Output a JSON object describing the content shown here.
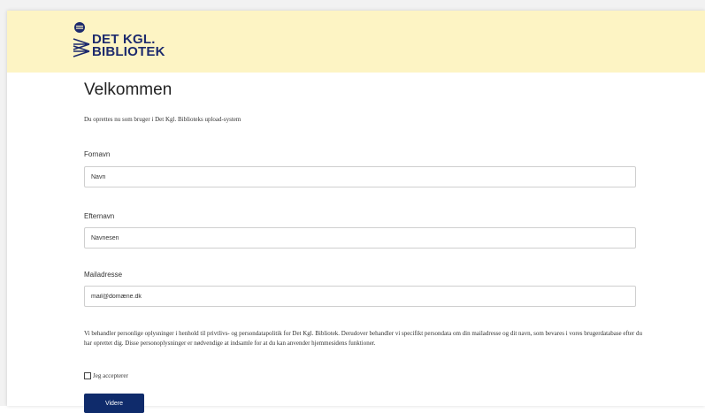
{
  "header": {
    "logo_line1": "DET KGL.",
    "logo_line2": "BIBLIOTEK",
    "background": "#fdf4c4",
    "brand_color": "#1d2a6d"
  },
  "main": {
    "title": "Velkommen",
    "subtitle": "Du oprettes nu som bruger i Det Kgl. Biblioteks upload-system"
  },
  "form": {
    "first_name": {
      "label": "Fornavn",
      "value": "Navn"
    },
    "last_name": {
      "label": "Efternavn",
      "value": "Navnesen"
    },
    "email": {
      "label": "Mailadresse",
      "value": "mail@domæne.dk"
    },
    "policy_text": "Vi behandler personlige oplysninger i henhold til privtlivs- og persondatapolitik for Det Kgl. Bibliotek. Derudover behandler vi specifikt persondata om din mailadresse og dit navn, som bevares i vores brugerdatabase efter du har oprettet dig. Disse personoplysninger er nødvendige at indsamle for at du kan anvender hjemmesidens funktioner.",
    "accept_label": "Jeg accepterer",
    "accept_checked": false,
    "submit_label": "Videre",
    "submit_color": "#0f2b6b"
  }
}
